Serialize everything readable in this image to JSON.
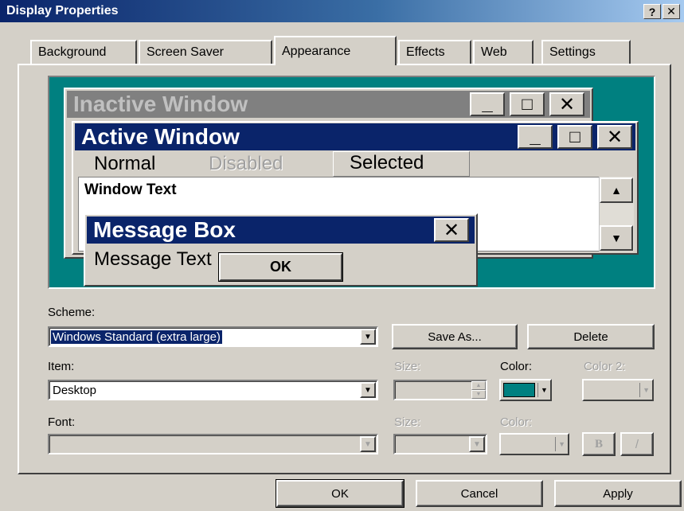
{
  "window": {
    "title": "Display Properties",
    "help_label": "?",
    "close_label": "✕"
  },
  "tabs": [
    {
      "label": "Background"
    },
    {
      "label": "Screen Saver"
    },
    {
      "label": "Appearance"
    },
    {
      "label": "Effects"
    },
    {
      "label": "Web"
    },
    {
      "label": "Settings"
    }
  ],
  "preview": {
    "desktop_color": "#008080",
    "inactive_title": "Inactive Window",
    "active_title": "Active Window",
    "menu_normal": "Normal",
    "menu_disabled": "Disabled",
    "menu_selected": "Selected",
    "window_text": "Window Text",
    "message_title": "Message Box",
    "message_text": "Message Text",
    "ok_label": "OK",
    "min_glyph": "_",
    "max_glyph": "□",
    "close_glyph": "✕"
  },
  "scheme": {
    "label": "Scheme:",
    "value": "Windows Standard (extra large)",
    "save_as_label": "Save As...",
    "delete_label": "Delete"
  },
  "item": {
    "label": "Item:",
    "value": "Desktop",
    "size_label": "Size:",
    "color_label": "Color:",
    "color2_label": "Color 2:",
    "color_value": "#008080"
  },
  "font": {
    "label": "Font:",
    "size_label": "Size:",
    "color_label": "Color:",
    "bold_label": "B",
    "italic_label": "/"
  },
  "footer": {
    "ok_label": "OK",
    "cancel_label": "Cancel",
    "apply_label": "Apply"
  }
}
